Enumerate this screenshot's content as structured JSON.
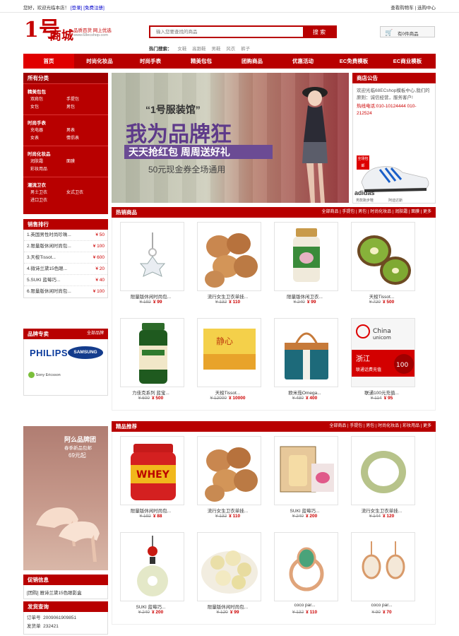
{
  "topbar": {
    "welcome": "您好，欢迎光临本店！",
    "login": "[登录]",
    "register": "[免费注册]",
    "cart_view": "查看购物车",
    "user_center": "选购中心"
  },
  "logo": {
    "mark": "1号",
    "name": "商城",
    "slogan": "品质百货 网上优选",
    "url": "www.68ecshop.com"
  },
  "search": {
    "placeholder": "输入您要查找的商品",
    "button": "搜 索",
    "hot_label": "热门搜索：",
    "hot": [
      "女鞋",
      "高跟鞋",
      "男鞋",
      "风衣",
      "裤子"
    ]
  },
  "cart": {
    "label": "有0件商品"
  },
  "nav": [
    "首页",
    "时尚化妆品",
    "时尚手表",
    "精美包包",
    "团购商品",
    "优惠活动",
    "EC免费模板",
    "EC商业模板"
  ],
  "category": {
    "title": "所有分类",
    "groups": [
      {
        "name": "精美包包",
        "items": [
          "双肩包",
          "手提包",
          "女包",
          "男包"
        ]
      },
      {
        "name": "时尚手表",
        "items": [
          "充电器",
          "男表",
          "女表",
          "情侣表"
        ]
      },
      {
        "name": "时尚化妆品",
        "items": [
          "润肤霜",
          "面膜",
          "彩妆用品"
        ]
      },
      {
        "name": "潮流卫衣",
        "items": [
          "男士卫衣",
          "女式卫衣",
          "进口卫衣"
        ]
      }
    ]
  },
  "sales_rank": {
    "title": "销售排行",
    "items": [
      {
        "name": "1.英国男性时尚珍珠...",
        "price": "¥ 50"
      },
      {
        "name": "2.限量版休闲时尚包...",
        "price": "¥ 100"
      },
      {
        "name": "3.天梭Tissot...",
        "price": "¥ 600"
      },
      {
        "name": "4.微诗兰黛15色眼...",
        "price": "¥ 20"
      },
      {
        "name": "5.SUKI 蓝莓巧...",
        "price": "¥ 40"
      },
      {
        "name": "6.限量版休闲时尚包...",
        "price": "¥ 100"
      }
    ]
  },
  "brands": {
    "title": "品牌专卖",
    "more": "全部品牌",
    "items": [
      "PHILIPS",
      "SAMSUNG",
      "Sony Ericsson"
    ]
  },
  "promo_ad": {
    "title": "阿么品牌团",
    "sub": "春季新品包邮",
    "price": "69元起"
  },
  "promo": {
    "title": "促销信息",
    "item": "[团购] 雅诗兰黛15色眼影盒"
  },
  "shipping": {
    "title": "发货查询",
    "rows": [
      {
        "label": "订单号",
        "value": "2009061909851"
      },
      {
        "label": "发货单",
        "value": "232421"
      }
    ]
  },
  "banner": {
    "tag": "“1号服装馆”",
    "headline": "我为品牌狂",
    "line1": "天天抢红包 周周送好礼",
    "line2": "50元现金券全场通用"
  },
  "notice": {
    "title": "商店公告",
    "text": "欢迎光临68ECshop模板中心,我们的原则：诚信经营，服务客户!",
    "phone": "热线电话:010-10124444 010-212524",
    "shoe_tag": "全场包邮",
    "shoe_caption1": "男款跑步鞋",
    "shoe_caption2": "阿迪达斯"
  },
  "hot_goods": {
    "title": "热销商品",
    "links": [
      "全部商品",
      "手提包",
      "男包",
      "时尚化妆品",
      "润肤霜",
      "面膜",
      "更多"
    ],
    "items": [
      {
        "name": "限量版休闲时尚包...",
        "old": "¥ 192",
        "price": "¥ 99"
      },
      {
        "name": "流行女生卫衣单挂...",
        "old": "¥ 132",
        "price": "¥ 110"
      },
      {
        "name": "限量版休闲卫衣...",
        "old": "¥ 240",
        "price": "¥ 99"
      },
      {
        "name": "天梭Tissot...",
        "old": "¥ 720",
        "price": "¥ 500"
      },
      {
        "name": "力佳克系列 蓝宝...",
        "old": "¥ 600",
        "price": "¥ 500"
      },
      {
        "name": "天梭Tissot...",
        "old": "¥ 12000",
        "price": "¥ 10000"
      },
      {
        "name": "欧米茄Omega...",
        "old": "¥ 480",
        "price": "¥ 400"
      },
      {
        "name": "联通100元充值...",
        "old": "¥ 114",
        "price": "¥ 95"
      }
    ]
  },
  "featured": {
    "title": "精品推荐",
    "links": [
      "全部商品",
      "手提包",
      "男包",
      "时尚化妆品",
      "彩妆用品",
      "更多"
    ],
    "items": [
      {
        "name": "限量版休闲时尚包...",
        "old": "¥ 192",
        "price": "¥ 88"
      },
      {
        "name": "流行女生卫衣单挂...",
        "old": "¥ 132",
        "price": "¥ 110"
      },
      {
        "name": "SUKI 蓝莓巧...",
        "old": "¥ 240",
        "price": "¥ 200"
      },
      {
        "name": "流行女生卫衣单挂...",
        "old": "¥ 144",
        "price": "¥ 120"
      },
      {
        "name": "SUKI 蓝莓巧...",
        "old": "¥ 240",
        "price": "¥ 200"
      },
      {
        "name": "限量版休闲时尚包...",
        "old": "¥ 120",
        "price": "¥ 99"
      },
      {
        "name": "coco par...",
        "old": "¥ 132",
        "price": "¥ 110"
      },
      {
        "name": "coco par...",
        "old": "¥ 90",
        "price": "¥ 70"
      }
    ]
  }
}
